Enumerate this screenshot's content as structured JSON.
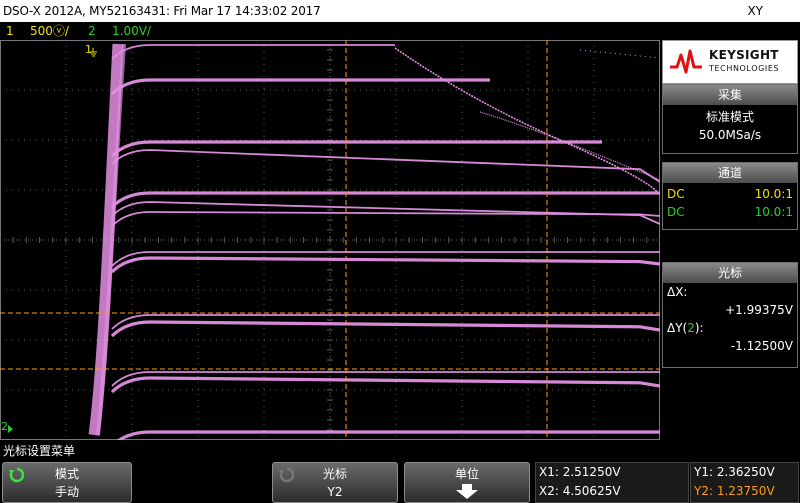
{
  "title_bar": {
    "title": "DSO-X 2012A, MY52163431: Fri Mar 17 14:33:02 2017",
    "mode": "XY"
  },
  "channels": {
    "ch1_num": "1",
    "ch1_scale": "500ⓥ/",
    "ch2_num": "2",
    "ch2_scale": "1.00V/",
    "ch1_marker": "1",
    "ch2_marker": "2"
  },
  "colors": {
    "trace": "#e38fe3",
    "ch1": "#f0e100",
    "ch2": "#27d027",
    "cursor": "#ff9a1a",
    "grid": "#5a5a5a"
  },
  "side_panel": {
    "brand": "KEYSIGHT",
    "brand_sub": "TECHNOLOGIES",
    "acquire": {
      "header": "采集",
      "mode": "标准模式",
      "rate": "50.0MSa/s"
    },
    "channels": {
      "header": "通道",
      "rows": [
        {
          "coupling": "DC",
          "probe": "10.0:1"
        },
        {
          "coupling": "DC",
          "probe": "10.0:1"
        }
      ]
    },
    "cursors": {
      "header": "光标",
      "dx_label": "ΔX:",
      "dx_value": "+1.99375V",
      "dy_label_pre": "ΔY(",
      "dy_label_num": "2",
      "dy_label_post": "):",
      "dy_value": "-1.12500V"
    }
  },
  "bottom": {
    "menu_title": "光标设置菜单",
    "softkeys": [
      {
        "label": "模式",
        "value": "手动"
      },
      {
        "label": "光标",
        "value": "Y2"
      },
      {
        "label": "单位",
        "value": ""
      }
    ],
    "x1": "X1: 2.51250V",
    "x2": "X2: 4.50625V",
    "y1": "Y1: 2.36250V",
    "y2": "Y2: 1.23750V"
  }
}
